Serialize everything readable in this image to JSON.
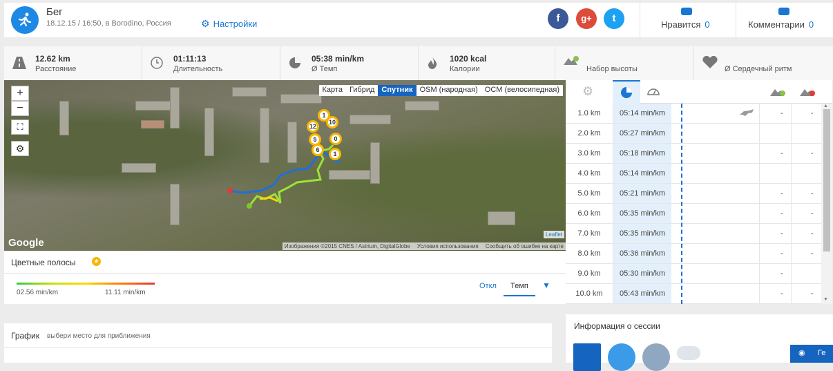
{
  "header": {
    "title": "Бег",
    "subtitle": "18.12.15 / 16:50, в Borodino, Россия",
    "settings_label": "Настройки",
    "social": [
      {
        "name": "facebook",
        "glyph": "f",
        "color": "#3b5998"
      },
      {
        "name": "google-plus",
        "glyph": "g+",
        "color": "#dd4b39"
      },
      {
        "name": "twitter",
        "glyph": "t",
        "color": "#1da1f2"
      }
    ],
    "likes_label": "Нравится",
    "likes_count": "0",
    "comments_label": "Комментарии",
    "comments_count": "0"
  },
  "stats": [
    {
      "value": "12.62 km",
      "label": "Расстояние",
      "icon": "road-icon"
    },
    {
      "value": "01:11:13",
      "label": "Длительность",
      "icon": "clock-icon"
    },
    {
      "value": "05:38 min/km",
      "label": "Ø Темп",
      "icon": "pace-icon"
    },
    {
      "value": "1020 kcal",
      "label": "Калории",
      "icon": "flame-icon"
    },
    {
      "value": "",
      "label": "Набор высоты",
      "icon": "elevation-up-icon"
    },
    {
      "value": "",
      "label": "Ø Сердечный ритм",
      "icon": "heart-icon"
    }
  ],
  "map": {
    "zoom_in": "+",
    "zoom_out": "−",
    "types": [
      "Карта",
      "Гибрид",
      "Спутник",
      "OSM (народная)",
      "OCM (велосипедная)"
    ],
    "active_type": "Спутник",
    "google_logo": "Google",
    "credits": [
      "Изображения ©2015 CNES / Astrium, DigitalGlobe",
      "Условия использования",
      "Сообщить об ошибке на карте"
    ],
    "leaflet_label": "Leaflet",
    "pins": [
      "1",
      "12",
      "10",
      "5",
      "0",
      "6",
      "1"
    ]
  },
  "color_bar": {
    "title": "Цветные полосы",
    "min_label": "02.56 min/km",
    "max_label": "11.11 min/km",
    "off_label": "Откл",
    "tempo_label": "Темп"
  },
  "splits": {
    "rows": [
      {
        "km": "1.0 km",
        "pace": "05:14 min/km",
        "c4": "-",
        "c5": "-",
        "runner": true
      },
      {
        "km": "2.0 km",
        "pace": "05:27 min/km",
        "c4": "",
        "c5": ""
      },
      {
        "km": "3.0 km",
        "pace": "05:18 min/km",
        "c4": "-",
        "c5": "-"
      },
      {
        "km": "4.0 km",
        "pace": "05:14 min/km",
        "c4": "",
        "c5": ""
      },
      {
        "km": "5.0 km",
        "pace": "05:21 min/km",
        "c4": "-",
        "c5": "-"
      },
      {
        "km": "6.0 km",
        "pace": "05:35 min/km",
        "c4": "-",
        "c5": "-"
      },
      {
        "km": "7.0 km",
        "pace": "05:35 min/km",
        "c4": "-",
        "c5": "-"
      },
      {
        "km": "8.0 km",
        "pace": "05:36 min/km",
        "c4": "-",
        "c5": "-"
      },
      {
        "km": "9.0 km",
        "pace": "05:30 min/km",
        "c4": "-",
        "c5": ""
      },
      {
        "km": "10.0 km",
        "pace": "05:43 min/km",
        "c4": "-",
        "c5": "-"
      }
    ]
  },
  "graph": {
    "title": "График",
    "hint": "выбери место для приближения"
  },
  "info": {
    "title": "Информация о сессии",
    "geo_label": "Ге"
  }
}
